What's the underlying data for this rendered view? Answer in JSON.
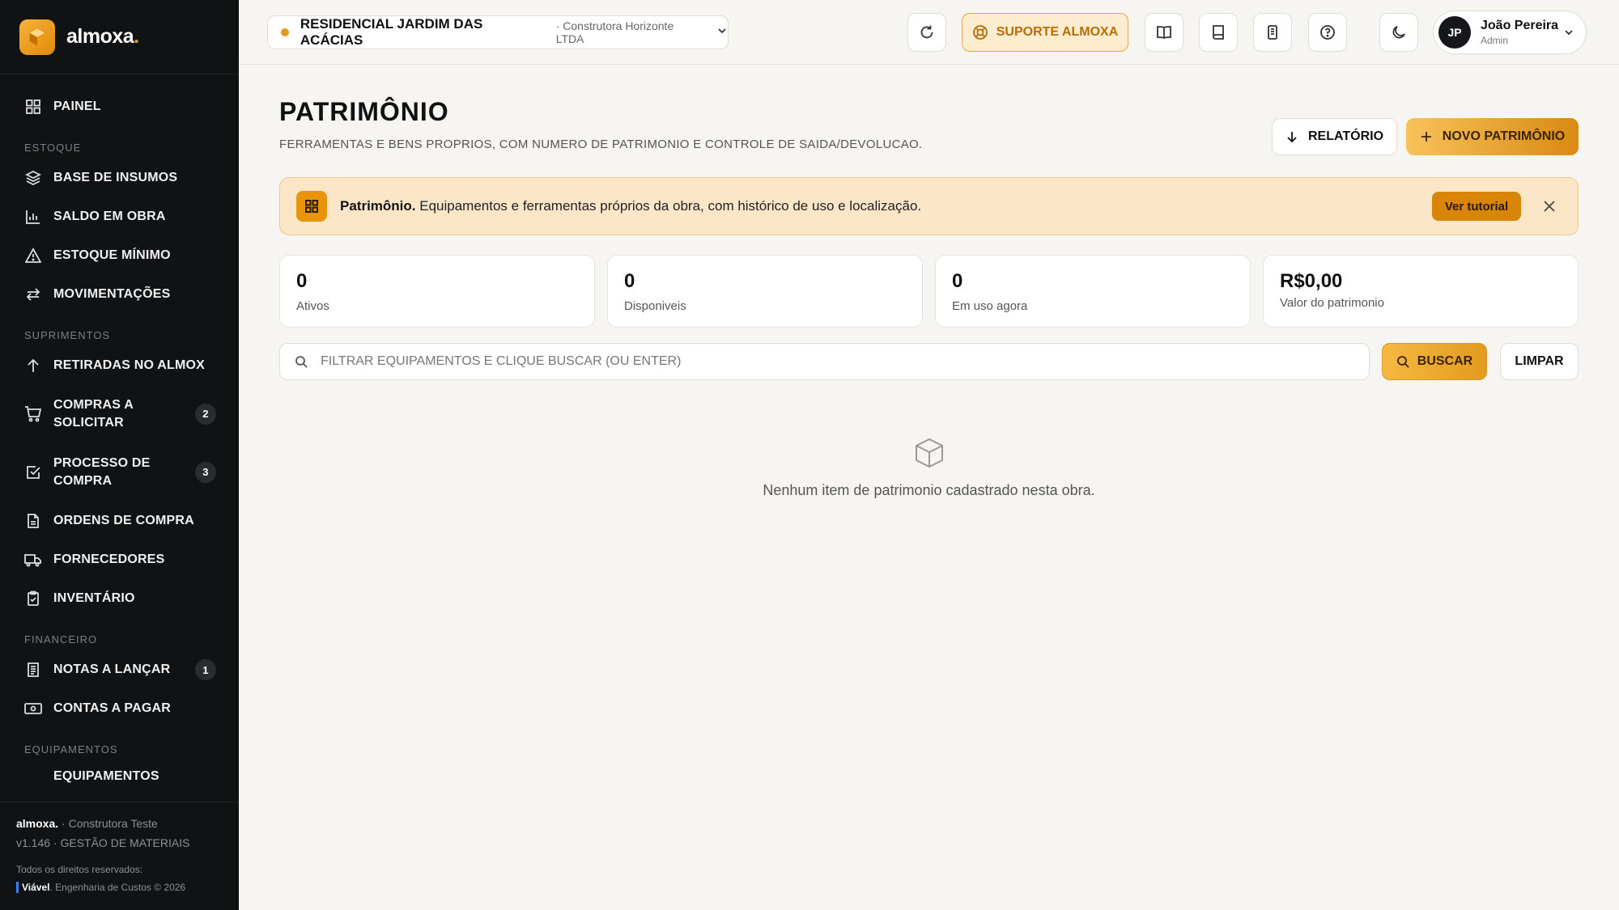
{
  "app": {
    "logo_text": "almoxa",
    "logo_dot": "."
  },
  "sidebar": {
    "items": [
      {
        "label": "PAINEL",
        "icon": "grid-icon"
      },
      {
        "section": "ESTOQUE"
      },
      {
        "label": "BASE DE INSUMOS",
        "icon": "layers-icon"
      },
      {
        "label": "SALDO EM OBRA",
        "icon": "bar-chart-icon"
      },
      {
        "label": "ESTOQUE MÍNIMO",
        "icon": "alert-triangle-icon"
      },
      {
        "label": "MOVIMENTAÇÕES",
        "icon": "arrows-icon"
      },
      {
        "section": "SUPRIMENTOS"
      },
      {
        "label": "RETIRADAS NO ALMOX",
        "icon": "arrow-up-icon"
      },
      {
        "label": "COMPRAS A SOLICITAR",
        "icon": "cart-icon",
        "badge": "2"
      },
      {
        "label": "PROCESSO DE COMPRA",
        "icon": "check-square-icon",
        "badge": "3"
      },
      {
        "label": "ORDENS DE COMPRA",
        "icon": "file-icon"
      },
      {
        "label": "FORNECEDORES",
        "icon": "truck-icon"
      },
      {
        "label": "INVENTÁRIO",
        "icon": "clipboard-icon"
      },
      {
        "section": "FINANCEIRO"
      },
      {
        "label": "NOTAS A LANÇAR",
        "icon": "receipt-icon",
        "badge": "1"
      },
      {
        "label": "CONTAS A PAGAR",
        "icon": "banknote-icon"
      },
      {
        "section": "EQUIPAMENTOS"
      },
      {
        "label": "EQUIPAMENTOS",
        "icon": "tool-icon"
      }
    ],
    "footer": {
      "brand": "almoxa.",
      "company": " · Construtora Teste",
      "version": "v1.146 · GESTÃO DE MATERIAIS",
      "rights": "Todos os direitos reservados:",
      "dev_brand": "Viável",
      "dev_text": ". Engenharia de Custos © 2026"
    }
  },
  "topbar": {
    "project_name": "RESIDENCIAL JARDIM DAS ACÁCIAS",
    "project_company": "· Construtora Horizonte LTDA",
    "support_label": "SUPORTE ALMOXA",
    "user_initials": "JP",
    "user_name": "João Pereira",
    "user_role": "Admin"
  },
  "page": {
    "title": "PATRIMÔNIO",
    "subtitle": "FERRAMENTAS E BENS PROPRIOS, COM NUMERO DE PATRIMONIO E CONTROLE DE SAIDA/DEVOLUCAO.",
    "report_label": "RELATÓRIO",
    "new_label": "NOVO PATRIMÔNIO"
  },
  "banner": {
    "title": "Patrimônio.",
    "text": " Equipamentos e ferramentas próprios da obra, com histórico de uso e localização.",
    "tutorial_label": "Ver tutorial"
  },
  "stats": [
    {
      "value": "0",
      "label": "Ativos"
    },
    {
      "value": "0",
      "label": "Disponiveis"
    },
    {
      "value": "0",
      "label": "Em uso agora"
    },
    {
      "value": "R$0,00",
      "label": "Valor do patrimonio"
    }
  ],
  "search": {
    "placeholder": "FILTRAR EQUIPAMENTOS E CLIQUE BUSCAR (OU ENTER)",
    "value": "",
    "search_label": "BUSCAR",
    "clear_label": "LIMPAR"
  },
  "empty": {
    "message": "Nenhum item de patrimonio cadastrado nesta obra."
  },
  "colors": {
    "accent": "#e8950d",
    "sidebar_bg": "#111214",
    "page_bg": "#f6f5f2"
  }
}
